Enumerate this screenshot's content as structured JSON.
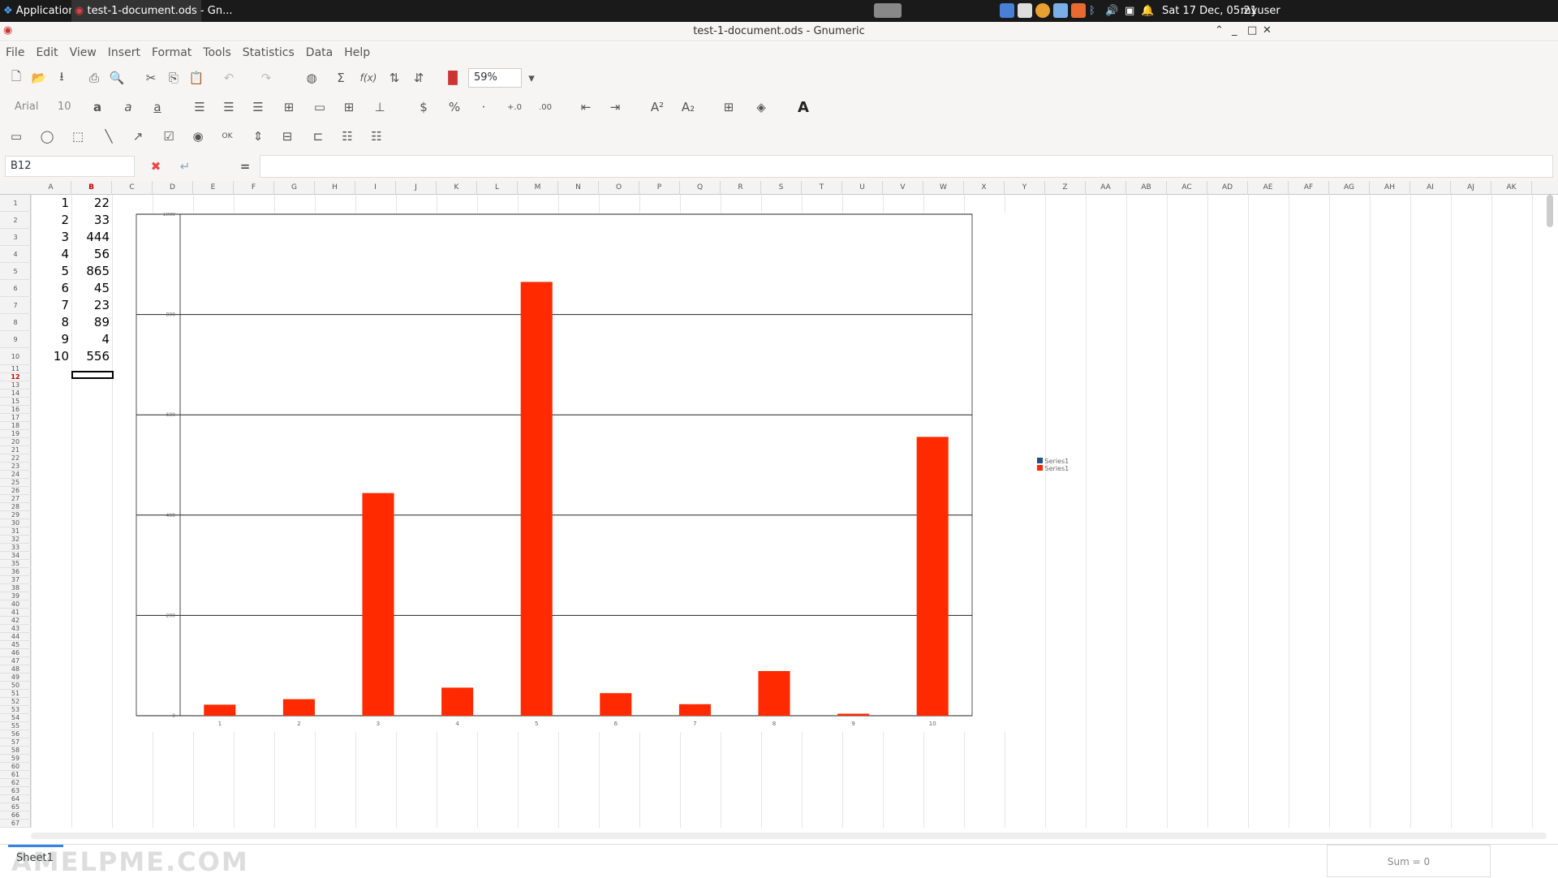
{
  "panel": {
    "apps": "Applications",
    "task": "test-1-document.ods - Gn...",
    "clock": "Sat 17 Dec, 05:21",
    "user": "myuser"
  },
  "window": {
    "title": "test-1-document.ods - Gnumeric"
  },
  "menu": [
    "File",
    "Edit",
    "View",
    "Insert",
    "Format",
    "Tools",
    "Statistics",
    "Data",
    "Help"
  ],
  "toolbar": {
    "zoom": "59%",
    "font": "Arial",
    "size": "10"
  },
  "formula": {
    "cellref": "B12",
    "eq": "="
  },
  "columns": [
    "A",
    "B",
    "C",
    "D",
    "E",
    "F",
    "G",
    "H",
    "I",
    "J",
    "K",
    "L",
    "M",
    "N",
    "O",
    "P",
    "Q",
    "R",
    "S",
    "T",
    "U",
    "V",
    "W",
    "X",
    "Y",
    "Z",
    "AA",
    "AB",
    "AC",
    "AD",
    "AE",
    "AF",
    "AG",
    "AH",
    "AI",
    "AJ",
    "AK"
  ],
  "cells": {
    "a": [
      "1",
      "2",
      "3",
      "4",
      "5",
      "6",
      "7",
      "8",
      "9",
      "10"
    ],
    "b": [
      "22",
      "33",
      "444",
      "56",
      "865",
      "45",
      "23",
      "89",
      "4",
      "556"
    ]
  },
  "chart_data": {
    "type": "bar",
    "categories": [
      "1",
      "2",
      "3",
      "4",
      "5",
      "6",
      "7",
      "8",
      "9",
      "10"
    ],
    "series": [
      {
        "name": "Series1",
        "values": [
          22,
          33,
          444,
          56,
          865,
          45,
          23,
          89,
          4,
          556
        ]
      }
    ],
    "ylim": [
      0,
      1000
    ],
    "yticks": [
      "0",
      "200",
      "400",
      "600",
      "800",
      "1000"
    ],
    "legend": [
      "Series1",
      "Series1"
    ],
    "legend_colors": [
      "#1f4e8c",
      "#ff2a00"
    ],
    "bar_color": "#ff2a00",
    "grid": true,
    "legend_position": "right"
  },
  "sheet": {
    "tab": "Sheet1",
    "status": "Sum = 0",
    "watermark": "AMELPME.COM"
  }
}
